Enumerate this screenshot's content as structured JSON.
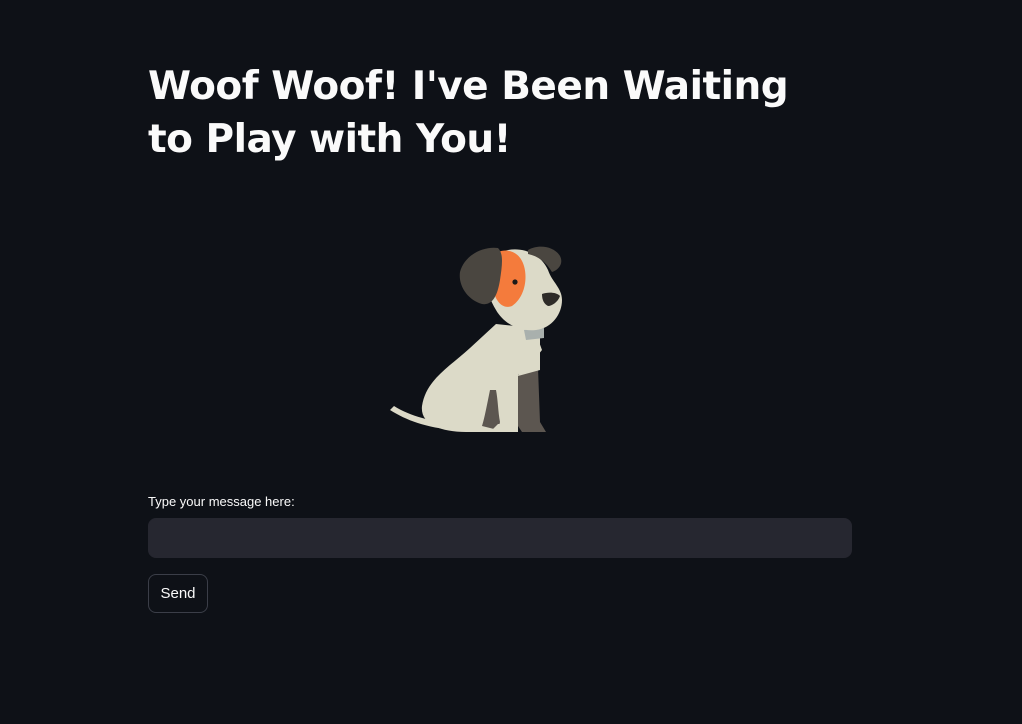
{
  "page": {
    "title": "Woof Woof! I've Been Waiting to Play with You!"
  },
  "image": {
    "icon": "sitting-dog-illustration"
  },
  "chat": {
    "input_label": "Type your message here:",
    "input_value": "",
    "input_placeholder": "",
    "send_label": "Send"
  },
  "colors": {
    "background": "#0e1117",
    "input_background": "#262730",
    "text": "#fafafa",
    "dog_body": "#dcdac8",
    "dog_ear": "#4a4640",
    "dog_patch": "#f47b3c"
  }
}
